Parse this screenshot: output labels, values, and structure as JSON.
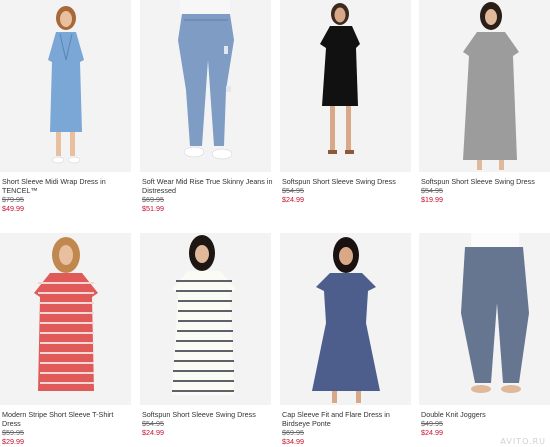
{
  "products": [
    {
      "name": "Short Sleeve Midi Wrap Dress in TENCEL™",
      "original_price": "$79.95",
      "sale_price": "$49.99",
      "garment": "light-blue wrap midi dress"
    },
    {
      "name": "Soft Wear Mid Rise True Skinny Jeans in Distressed",
      "original_price": "$69.95",
      "sale_price": "$51.99",
      "garment": "distressed skinny jeans"
    },
    {
      "name": "Softspun Short Sleeve Swing Dress",
      "original_price": "$54.95",
      "sale_price": "$24.99",
      "garment": "black swing dress"
    },
    {
      "name": "Softspun Short Sleeve Swing Dress",
      "original_price": "$54.95",
      "sale_price": "$19.99",
      "garment": "heather grey swing dress"
    },
    {
      "name": "Modern Stripe Short Sleeve T-Shirt Dress",
      "original_price": "$59.95",
      "sale_price": "$29.99",
      "garment": "red striped t-shirt dress"
    },
    {
      "name": "Softspun Short Sleeve Swing Dress",
      "original_price": "$54.95",
      "sale_price": "$24.99",
      "garment": "white and navy striped swing dress"
    },
    {
      "name": "Cap Sleeve Fit and Flare Dress in Birdseye Ponte",
      "original_price": "$69.95",
      "sale_price": "$34.99",
      "garment": "blue fit and flare dress"
    },
    {
      "name": "Double Knit Joggers",
      "original_price": "$49.95",
      "sale_price": "$24.99",
      "garment": "heather blue joggers"
    }
  ],
  "watermark": "AVITO.RU",
  "colors": {
    "sale": "#c8102e",
    "photo_background": "#f1f1f1"
  }
}
